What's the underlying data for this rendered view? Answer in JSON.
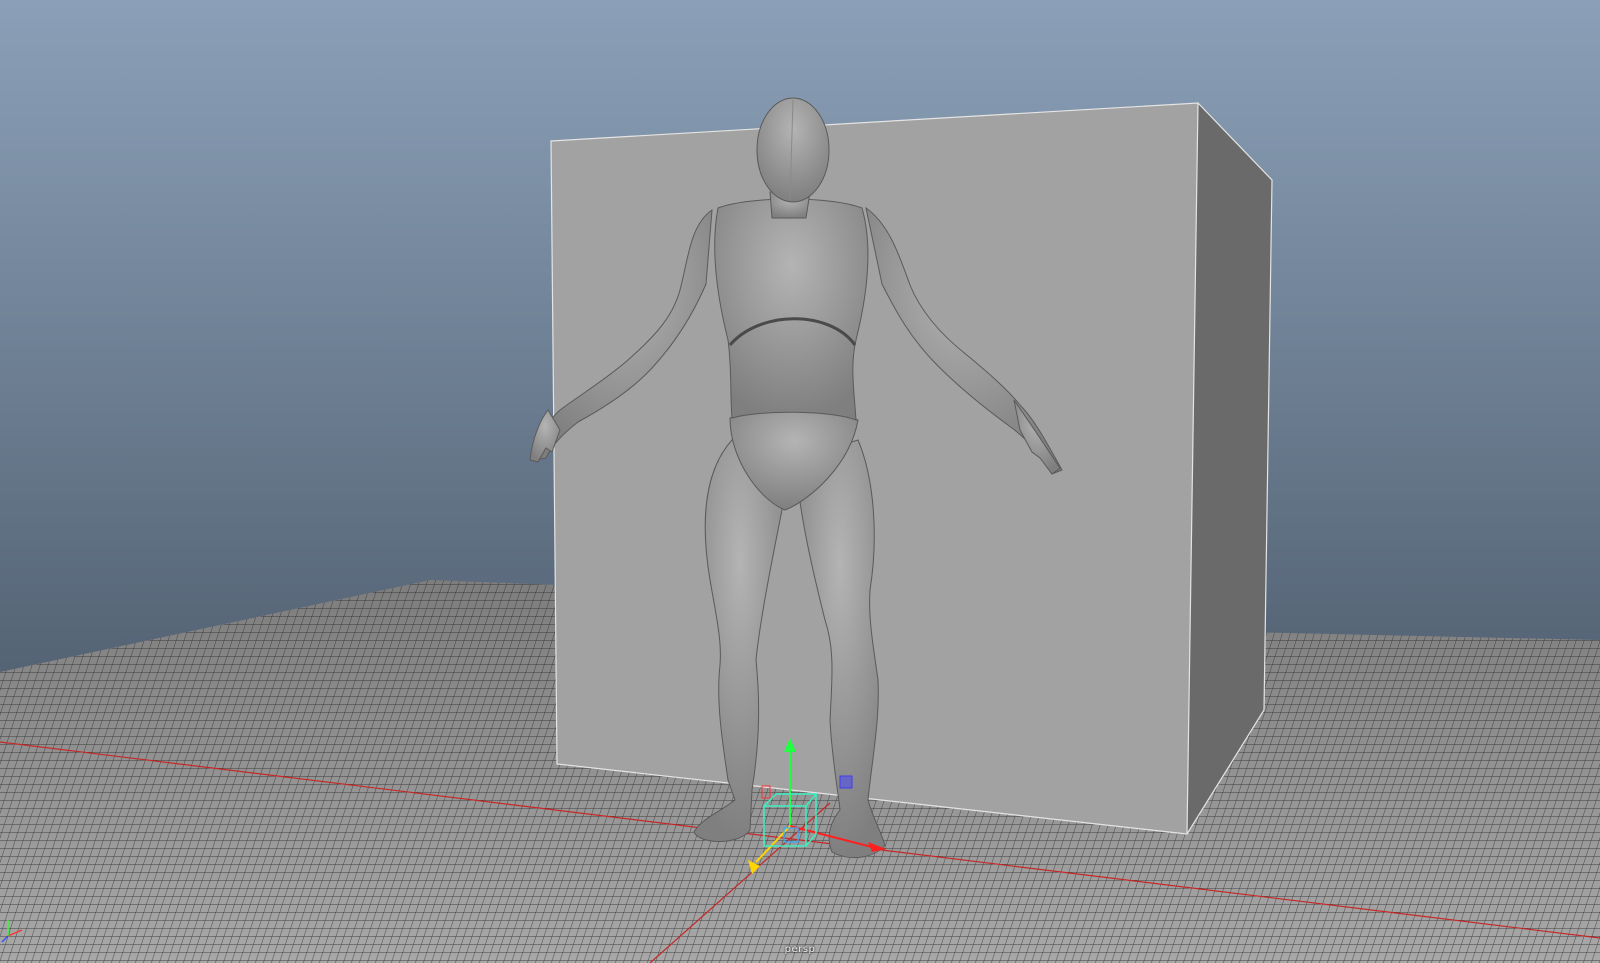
{
  "viewport": {
    "camera_name": "persp",
    "background_top_color": "#8ba0b8",
    "background_bottom_color": "#3c4957"
  },
  "scene": {
    "grid": {
      "visible": true,
      "line_color": "#2b2b2b",
      "axis_x_color": "#c62828",
      "axis_z_color": "#c62828"
    },
    "objects": [
      {
        "name": "cube",
        "type": "polyCube",
        "shading": "smooth-shaded",
        "color": "#a0a0a0"
      },
      {
        "name": "mannequin",
        "type": "mesh",
        "pose": "A-pose",
        "shading": "smooth-shaded",
        "color": "#9c9c9c"
      }
    ],
    "manipulator": {
      "type": "move-tool",
      "x_color": "#ff2020",
      "y_color": "#20ff40",
      "z_color": "#ffd400",
      "selection_color": "#3cf0c0"
    },
    "view_axis_icon": {
      "x_color": "#ff3030",
      "y_color": "#30ff30",
      "z_color": "#3050ff"
    }
  }
}
